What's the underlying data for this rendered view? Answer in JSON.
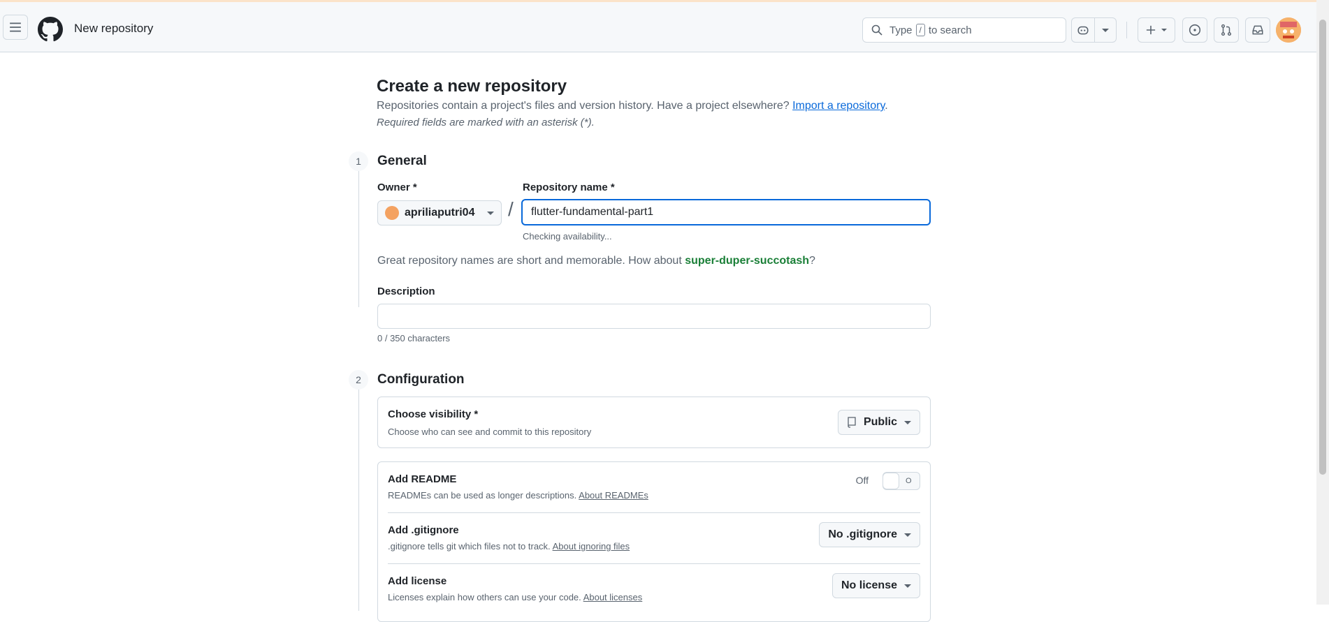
{
  "header": {
    "title": "New repository",
    "search_placeholder_prefix": "Type",
    "search_key": "/",
    "search_placeholder_suffix": "to search"
  },
  "intro": {
    "heading": "Create a new repository",
    "text": "Repositories contain a project's files and version history. Have a project elsewhere?",
    "import_link": "Import a repository",
    "period": ".",
    "required_note": "Required fields are marked with an asterisk (*)."
  },
  "general": {
    "step": "1",
    "title": "General",
    "owner_label": "Owner *",
    "owner_value": "apriliaputri04",
    "slash": "/",
    "repo_label": "Repository name *",
    "repo_value": "flutter-fundamental-part1",
    "checking": "Checking availability...",
    "suggest_text": "Great repository names are short and memorable. How about",
    "suggest_name": "super-duper-succotash",
    "suggest_end": "?",
    "description_label": "Description",
    "description_value": "",
    "char_count": "0 / 350 characters"
  },
  "configuration": {
    "step": "2",
    "title": "Configuration",
    "visibility_title": "Choose visibility *",
    "visibility_desc": "Choose who can see and commit to this repository",
    "visibility_value": "Public",
    "readme_title": "Add README",
    "readme_desc": "READMEs can be used as longer descriptions.",
    "readme_link": "About READMEs",
    "readme_toggle_label": "Off",
    "readme_toggle_glyph": "O",
    "gitignore_title": "Add .gitignore",
    "gitignore_desc": ".gitignore tells git which files not to track.",
    "gitignore_link": "About ignoring files",
    "gitignore_value": "No .gitignore",
    "license_title": "Add license",
    "license_desc": "Licenses explain how others can use your code.",
    "license_link": "About licenses",
    "license_value": "No license"
  },
  "icons": [
    "hamburger-icon",
    "github-logo-icon",
    "search-icon",
    "copilot-icon",
    "chevron-down-icon",
    "plus-icon",
    "issues-icon",
    "pull-requests-icon",
    "inbox-icon",
    "repo-icon"
  ],
  "colors": {
    "accent": "#0969da",
    "suggest_green": "#1a7f37",
    "border": "#d1d9e0"
  }
}
